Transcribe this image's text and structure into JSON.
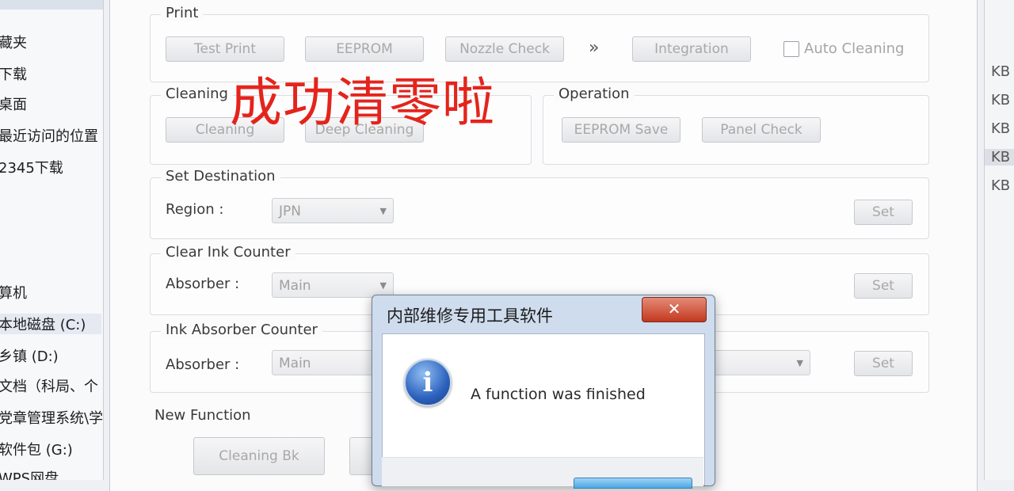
{
  "explorer_sidebar": {
    "items": [
      {
        "label": "藏夹"
      },
      {
        "label": "下载"
      },
      {
        "label": "桌面"
      },
      {
        "label": "最近访问的位置"
      },
      {
        "label": "2345下载"
      },
      {
        "label": "算机"
      },
      {
        "label": "本地磁盘 (C:)"
      },
      {
        "label": "乡镇 (D:)"
      },
      {
        "label": "文档（科局、个"
      },
      {
        "label": "党章管理系统\\学"
      },
      {
        "label": "软件包 (G:)"
      },
      {
        "label": "WPS网盘"
      }
    ]
  },
  "file_list": {
    "sizes": [
      "KB",
      "KB",
      "KB",
      "KB",
      "KB"
    ]
  },
  "tool": {
    "print": {
      "label": "Print",
      "buttons": {
        "test_print": "Test Print",
        "eeprom": "EEPROM",
        "nozzle_check": "Nozzle Check",
        "more": "»",
        "integration": "Integration"
      },
      "auto_cleaning": "Auto Cleaning"
    },
    "cleaning": {
      "label": "Cleaning",
      "buttons": {
        "cleaning": "Cleaning",
        "deep_cleaning": "Deep Cleaning"
      }
    },
    "operation": {
      "label": "Operation",
      "buttons": {
        "eeprom_save": "EEPROM Save",
        "panel_check": "Panel Check"
      }
    },
    "set_destination": {
      "label": "Set Destination",
      "field_label": "Region :",
      "value": "JPN",
      "set": "Set"
    },
    "clear_ink_counter": {
      "label": "Clear Ink Counter",
      "field_label": "Absorber :",
      "value": "Main",
      "set": "Set"
    },
    "ink_absorber_counter": {
      "label": "Ink Absorber Counter",
      "field_label": "Absorber :",
      "value": "Main",
      "set": "Set"
    },
    "new_function": {
      "label": "New Function",
      "cleaning_bk": "Cleaning Bk"
    }
  },
  "overlay": {
    "text": "成功清零啦",
    "color": "#e4241c"
  },
  "dialog": {
    "title": "内部维修专用工具软件",
    "close": "✕",
    "message": "A function was finished",
    "icon": "info-icon"
  }
}
